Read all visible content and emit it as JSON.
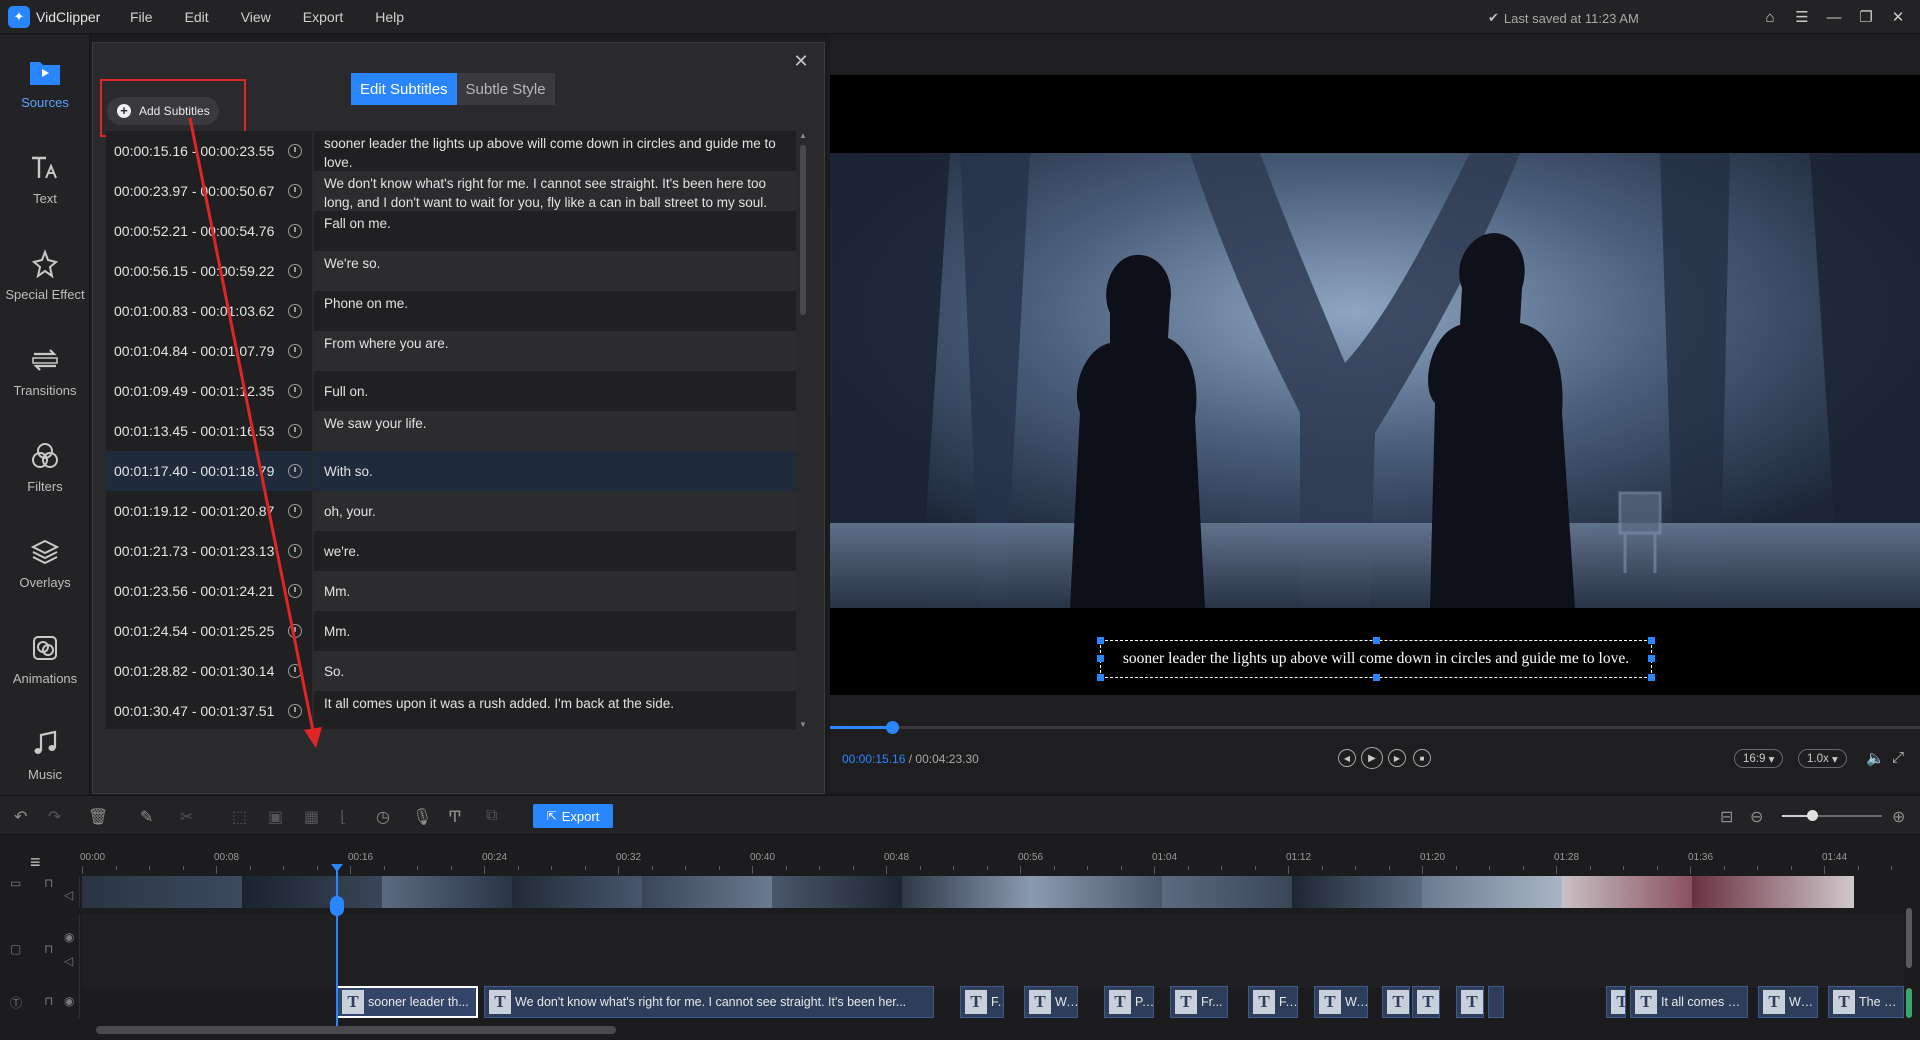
{
  "app": {
    "name": "VidClipper",
    "saved_status": "Last saved at 11:23 AM"
  },
  "menu": [
    "File",
    "Edit",
    "View",
    "Export",
    "Help"
  ],
  "sidebar": {
    "items": [
      {
        "label": "Sources",
        "icon": "play-folder-icon",
        "active": true
      },
      {
        "label": "Text",
        "icon": "text-icon"
      },
      {
        "label": "Special Effect",
        "icon": "sparkle-icon"
      },
      {
        "label": "Transitions",
        "icon": "transition-icon"
      },
      {
        "label": "Filters",
        "icon": "filters-icon"
      },
      {
        "label": "Overlays",
        "icon": "layers-icon"
      },
      {
        "label": "Animations",
        "icon": "animation-icon"
      },
      {
        "label": "Music",
        "icon": "music-note-icon"
      }
    ]
  },
  "subtitle_panel": {
    "add_button": "Add Subtitles",
    "tabs": [
      {
        "label": "Edit Subtitles",
        "active": true
      },
      {
        "label": "Subtle Style",
        "active": false
      }
    ],
    "rows": [
      {
        "time": "00:00:15.16 - 00:00:23.55",
        "text": "sooner leader the lights up above will come down in circles and guide me to love."
      },
      {
        "time": "00:00:23.97 - 00:00:50.67",
        "text": "We don't know what's right for me. I cannot see straight. It's been here too long, and I don't want to wait for you, fly like a can in ball street to my soul."
      },
      {
        "time": "00:00:52.21 - 00:00:54.76",
        "text": "Fall on me."
      },
      {
        "time": "00:00:56.15 - 00:00:59.22",
        "text": "We're so."
      },
      {
        "time": "00:01:00.83 - 00:01:03.62",
        "text": "Phone on me."
      },
      {
        "time": "00:01:04.84 - 00:01:07.79",
        "text": "From where you are."
      },
      {
        "time": "00:01:09.49 - 00:01:12.35",
        "text": "Full on."
      },
      {
        "time": "00:01:13.45 - 00:01:16.53",
        "text": "We saw your life."
      },
      {
        "time": "00:01:17.40 - 00:01:18.79",
        "text": "With so."
      },
      {
        "time": "00:01:19.12 - 00:01:20.87",
        "text": "oh, your."
      },
      {
        "time": "00:01:21.73 - 00:01:23.13",
        "text": "we're."
      },
      {
        "time": "00:01:23.56 - 00:01:24.21",
        "text": "Mm."
      },
      {
        "time": "00:01:24.54 - 00:01:25.25",
        "text": "Mm."
      },
      {
        "time": "00:01:28.82 - 00:01:30.14",
        "text": "So."
      },
      {
        "time": "00:01:30.47 - 00:01:37.51",
        "text": "It all comes upon it was a rush added. I'm back at the side."
      }
    ]
  },
  "preview": {
    "subtitle_text": "sooner leader the lights up above will come down in circles and guide me to love.",
    "current_time": "00:00:15.16",
    "total_time": "/ 00:04:23.30",
    "progress": 0.057,
    "aspect": "16:9",
    "speed": "1.0x"
  },
  "toolbar": {
    "export_label": "Export",
    "zoom_level": 0.3
  },
  "timeline": {
    "ruler": [
      "00:00",
      "00:08",
      "00:16",
      "00:24",
      "00:32",
      "00:40",
      "00:48",
      "00:56",
      "01:04",
      "01:12",
      "01:20",
      "01:28",
      "01:36",
      "01:44"
    ],
    "subtitle_clips": [
      "sooner leader th...",
      "We don't know what's right for me. I cannot see straight. It's been her...",
      "F...",
      "W...",
      "P...",
      "Fr...",
      "F...",
      "W...",
      "",
      "",
      "",
      "",
      "It all comes u...",
      "We...",
      "The heart ha"
    ]
  },
  "colors": {
    "accent": "#2a86ff",
    "annotation": "#e02525"
  }
}
